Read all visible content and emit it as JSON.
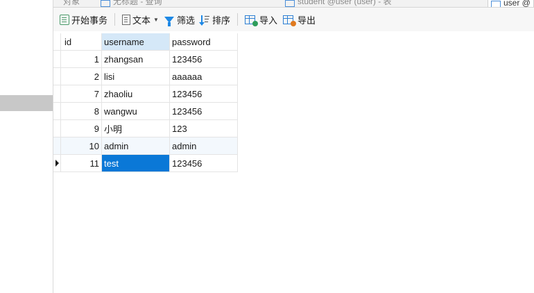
{
  "tabs": [
    {
      "label": "对象",
      "active": false
    },
    {
      "label": "无标题 - 查询",
      "active": false
    },
    {
      "label": "student @user (user) - 表",
      "active": false
    },
    {
      "label": "user @",
      "active": true
    }
  ],
  "toolbar": {
    "begin_transaction": "开始事务",
    "text": "文本",
    "filter": "筛选",
    "sort": "排序",
    "import": "导入",
    "export": "导出"
  },
  "grid": {
    "columns": [
      "id",
      "username",
      "password"
    ],
    "rows": [
      {
        "id": "1",
        "username": "zhangsan",
        "password": "123456"
      },
      {
        "id": "2",
        "username": "lisi",
        "password": "aaaaaa"
      },
      {
        "id": "7",
        "username": "zhaoliu",
        "password": "123456"
      },
      {
        "id": "8",
        "username": "wangwu",
        "password": "123456"
      },
      {
        "id": "9",
        "username": "小明",
        "password": "123"
      },
      {
        "id": "10",
        "username": "admin",
        "password": "admin"
      },
      {
        "id": "11",
        "username": "test",
        "password": "123456"
      }
    ],
    "current_row": 6
  },
  "colors": {
    "selection": "#0a78d7",
    "header_highlight": "#d5e8f8",
    "alt_row": "#f3f8fd",
    "left_selection": "#c8c8c8"
  }
}
